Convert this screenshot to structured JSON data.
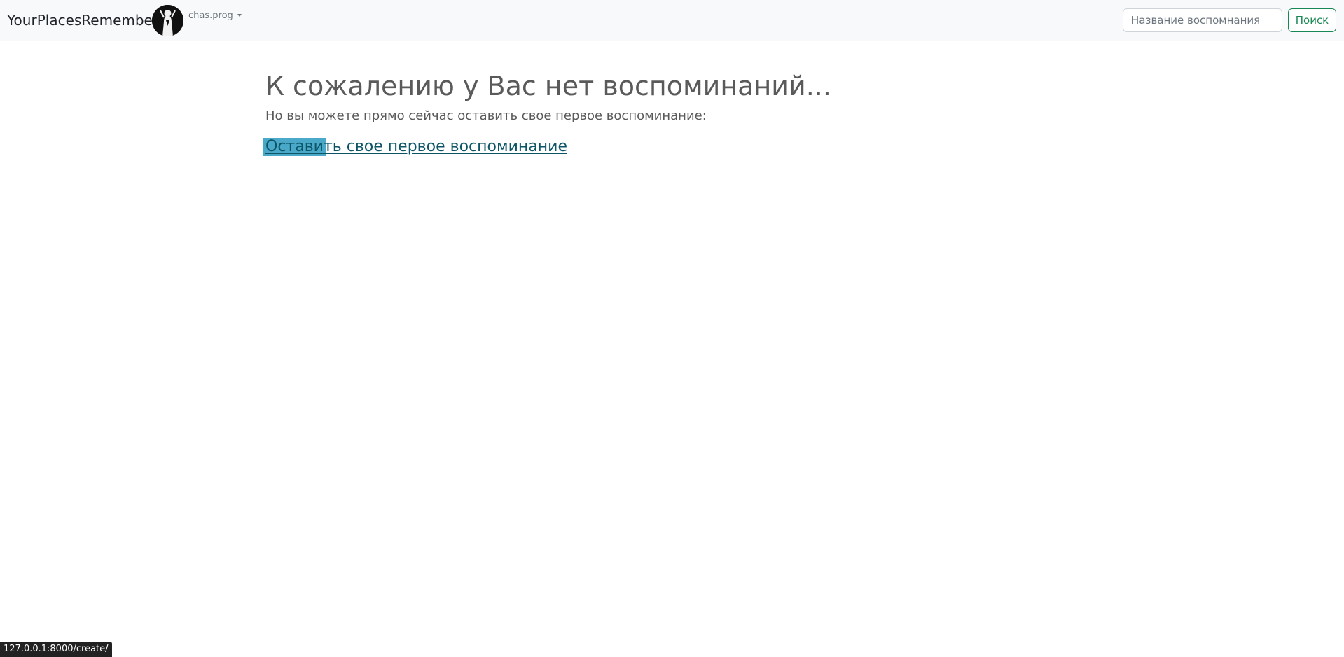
{
  "navbar": {
    "brand": "YourPlacesRemember",
    "avatar_icon": "user-avatar-icon",
    "username": "chas.prog",
    "search": {
      "placeholder": "Название воспомнания",
      "value": "",
      "button_label": "Поиск"
    }
  },
  "main": {
    "heading": "К сожалению у Вас нет воспоминаний...",
    "subtext": "Но вы можете прямо сейчас оставить свое первое воспоминание:",
    "create_link_label": "Оставить свое первое воспоминание"
  },
  "status_bar": {
    "url": "127.0.0.1:8000/create/"
  },
  "colors": {
    "navbar_bg": "#f8f9fa",
    "accent_success": "#198754",
    "link": "#0b5566",
    "link_highlight": "#4aa8c8",
    "heading_text": "#5a5a5a"
  }
}
